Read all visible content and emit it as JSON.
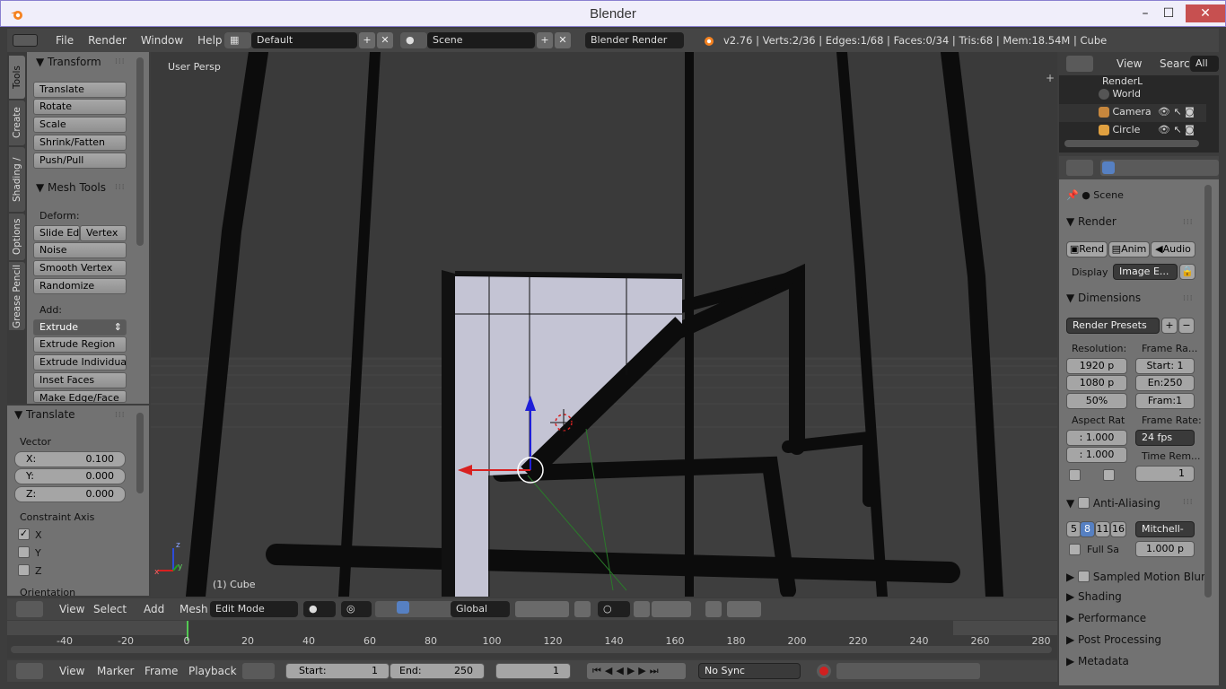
{
  "window": {
    "title": "Blender",
    "minimize": "–",
    "maximize": "☐",
    "close": "✕"
  },
  "topbar": {
    "menus": [
      "File",
      "Render",
      "Window",
      "Help"
    ],
    "layout": "Default",
    "scene": "Scene",
    "engine": "Blender Render",
    "info": "v2.76 | Verts:2/36 | Edges:1/68 | Faces:0/34 | Tris:68 | Mem:18.54M | Cube"
  },
  "left_tabs": [
    "Tools",
    "Create",
    "Shading / UVs",
    "Options",
    "Grease Pencil"
  ],
  "tools": {
    "transform_title": "Transform",
    "transform_buttons": [
      "Translate",
      "Rotate",
      "Scale",
      "Shrink/Fatten",
      "Push/Pull"
    ],
    "mesh_tools_title": "Mesh Tools",
    "deform_label": "Deform:",
    "slide_edge": "Slide Ed",
    "vertex": "Vertex",
    "deform_buttons": [
      "Noise",
      "Smooth Vertex",
      "Randomize"
    ],
    "add_label": "Add:",
    "extrude": "Extrude",
    "add_buttons": [
      "Extrude Region",
      "Extrude Individual",
      "Inset Faces",
      "Make Edge/Face"
    ]
  },
  "operator": {
    "title": "Translate",
    "vector_label": "Vector",
    "x_key": "X:",
    "x_val": "0.100",
    "y_key": "Y:",
    "y_val": "0.000",
    "z_key": "Z:",
    "z_val": "0.000",
    "constraint_label": "Constraint Axis",
    "cx": "X",
    "cy": "Y",
    "cz": "Z",
    "cx_checked": true,
    "orientation_label": "Orientation"
  },
  "viewport": {
    "persp_label": "User Persp",
    "object_label": "(1) Cube",
    "axis_x": "x",
    "axis_y": "y",
    "axis_z": "z"
  },
  "view_header": {
    "menus": [
      "View",
      "Select",
      "Add",
      "Mesh"
    ],
    "mode": "Edit Mode",
    "orientation": "Global"
  },
  "timeline": {
    "ticks": [
      "-40",
      "-20",
      "0",
      "20",
      "40",
      "60",
      "80",
      "100",
      "120",
      "140",
      "160",
      "180",
      "200",
      "220",
      "240",
      "260",
      "280"
    ],
    "menus": [
      "View",
      "Marker",
      "Frame",
      "Playback"
    ],
    "start_label": "Start:",
    "start_val": "1",
    "end_label": "End:",
    "end_val": "250",
    "current": "1",
    "sync": "No Sync"
  },
  "outliner": {
    "view": "View",
    "search": "Search",
    "all_scenes": "All Sc",
    "items": [
      "RenderL",
      "World",
      "Camera",
      "Circle"
    ]
  },
  "properties": {
    "scene": "Scene",
    "render_title": "Render",
    "render_btn": "Rend",
    "anim_btn": "Anim",
    "audio_btn": "Audio",
    "display_label": "Display",
    "display_val": "Image E...",
    "dimensions_title": "Dimensions",
    "presets": "Render Presets",
    "resolution_label": "Resolution:",
    "frame_range_label": "Frame Ra...",
    "res_x": "1920 p",
    "res_y": "1080 p",
    "res_pct": "50%",
    "start": "Start: 1",
    "end": "En:250",
    "frame": "Fram:1",
    "aspect_label": "Aspect Rat",
    "framerate_label": "Frame Rate:",
    "aspect_x": ": 1.000",
    "aspect_y": ": 1.000",
    "fps": "24 fps",
    "time_remap_label": "Time Rem...",
    "time_remap_val": "1",
    "aa_title": "Anti-Aliasing",
    "aa_samples": [
      "5",
      "8",
      "11",
      "16"
    ],
    "aa_filter": "Mitchell-",
    "full_sample": "Full Sa",
    "aa_size": "1.000 p",
    "sampled_motion_blur": "Sampled Motion Blur",
    "shading": "Shading",
    "performance": "Performance",
    "post_processing": "Post Processing",
    "metadata": "Metadata"
  },
  "colors": {
    "accent": "#5680c2",
    "panel": "#727272",
    "header": "#454545",
    "viewport": "#393939"
  }
}
